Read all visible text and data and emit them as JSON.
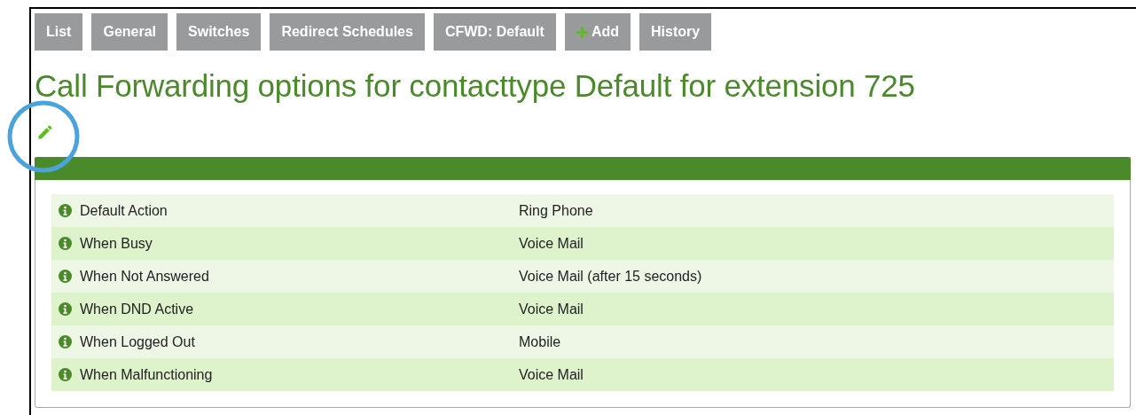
{
  "tabs": [
    {
      "label": "List",
      "kind": "plain"
    },
    {
      "label": "General",
      "kind": "plain"
    },
    {
      "label": "Switches",
      "kind": "plain"
    },
    {
      "label": "Redirect Schedules",
      "kind": "plain"
    },
    {
      "label": "CFWD: Default",
      "kind": "plain"
    },
    {
      "label": "Add",
      "kind": "add"
    },
    {
      "label": "History",
      "kind": "plain"
    }
  ],
  "title": "Call Forwarding options for contacttype Default for extension 725",
  "rows": [
    {
      "label": "Default Action",
      "value": "Ring Phone"
    },
    {
      "label": "When Busy",
      "value": "Voice Mail"
    },
    {
      "label": "When Not Answered",
      "value": "Voice Mail (after 15  seconds)"
    },
    {
      "label": "When DND Active",
      "value": "Voice Mail"
    },
    {
      "label": "When Logged Out",
      "value": "Mobile"
    },
    {
      "label": "When Malfunctioning",
      "value": "Voice Mail"
    }
  ]
}
